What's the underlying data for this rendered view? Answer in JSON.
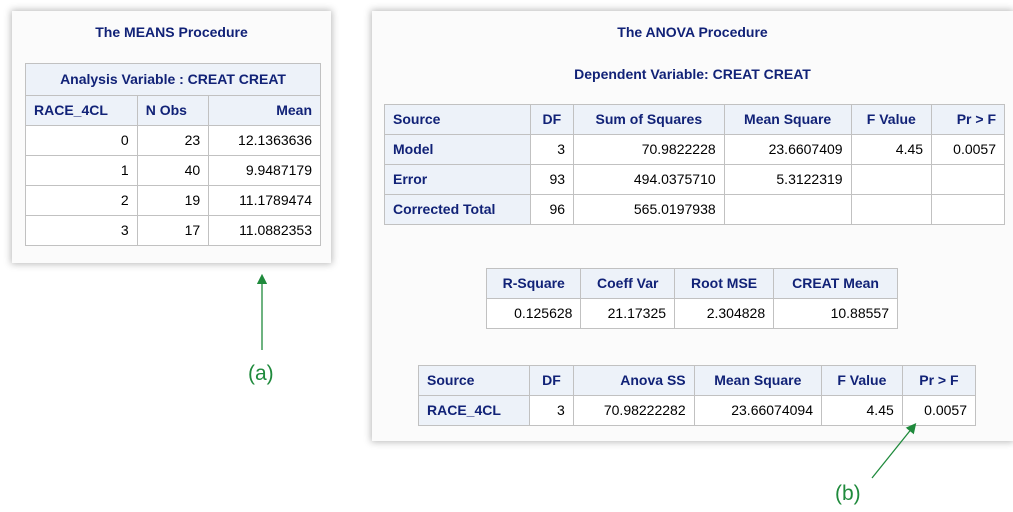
{
  "means": {
    "title": "The MEANS Procedure",
    "analysis_header": "Analysis Variable : CREAT CREAT",
    "columns": [
      "RACE_4CL",
      "N Obs",
      "Mean"
    ],
    "rows": [
      [
        "0",
        "23",
        "12.1363636"
      ],
      [
        "1",
        "40",
        "9.9487179"
      ],
      [
        "2",
        "19",
        "11.1789474"
      ],
      [
        "3",
        "17",
        "11.0882353"
      ]
    ]
  },
  "anova": {
    "title": "The ANOVA Procedure",
    "dependent": "Dependent Variable: CREAT CREAT",
    "table": {
      "columns": [
        "Source",
        "DF",
        "Sum of Squares",
        "Mean Square",
        "F Value",
        "Pr > F"
      ],
      "rows": [
        [
          "Model",
          "3",
          "70.9822228",
          "23.6607409",
          "4.45",
          "0.0057"
        ],
        [
          "Error",
          "93",
          "494.0375710",
          "5.3122319",
          "",
          ""
        ],
        [
          "Corrected Total",
          "96",
          "565.0197938",
          "",
          "",
          ""
        ]
      ]
    },
    "fit": {
      "columns": [
        "R-Square",
        "Coeff Var",
        "Root MSE",
        "CREAT Mean"
      ],
      "values": [
        "0.125628",
        "21.17325",
        "2.304828",
        "10.88557"
      ]
    },
    "type": {
      "columns": [
        "Source",
        "DF",
        "Anova SS",
        "Mean Square",
        "F Value",
        "Pr > F"
      ],
      "rows": [
        [
          "RACE_4CL",
          "3",
          "70.98222282",
          "23.66074094",
          "4.45",
          "0.0057"
        ]
      ]
    }
  },
  "annotations": {
    "a": "(a)",
    "b": "(b)",
    "color": "#1f8a3c"
  },
  "colors": {
    "header_bg": "#edf2f9",
    "header_text": "#112277",
    "border": "#c1c1c1"
  }
}
